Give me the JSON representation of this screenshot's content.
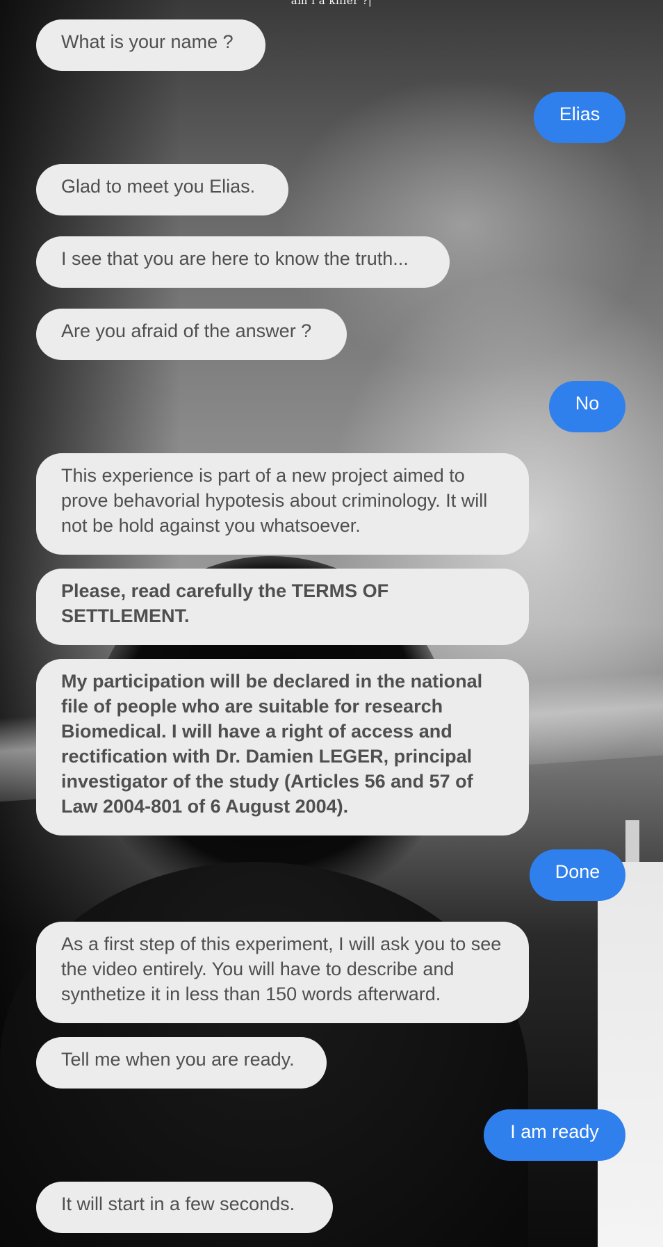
{
  "page": {
    "title": "am i a killer ?|"
  },
  "messages": [
    {
      "sender": "bot",
      "text": "What is your name ?"
    },
    {
      "sender": "user",
      "text": "Elias"
    },
    {
      "sender": "bot",
      "text": "Glad to meet you Elias."
    },
    {
      "sender": "bot",
      "text": "I see that you are here to know the truth..."
    },
    {
      "sender": "bot",
      "text": "Are you afraid of the answer ?"
    },
    {
      "sender": "user",
      "text": "No"
    },
    {
      "sender": "bot",
      "text": "This experience is part of a new project aimed to prove behavorial hypotesis about criminology. It will not be hold against you whatsoever."
    },
    {
      "sender": "bot",
      "text": "Please, read carefully the TERMS OF SETTLEMENT.",
      "bold": true
    },
    {
      "sender": "bot",
      "text": "My participation will be declared in the national file of people who are suitable for research Biomedical. I will have a right of access and rectification with Dr. Damien LEGER, principal investigator of the study (Articles 56 and 57 of Law 2004-801 of 6 August 2004).",
      "bold": true
    },
    {
      "sender": "user",
      "text": "Done"
    },
    {
      "sender": "bot",
      "text": "As a first step of this experiment, I will ask you to see the video entirely. You will have to describe and synthetize it in less than 150 words afterward."
    },
    {
      "sender": "bot",
      "text": "Tell me when you are ready."
    },
    {
      "sender": "user",
      "text": "I am ready"
    },
    {
      "sender": "bot",
      "text": "It will start in a few seconds."
    }
  ],
  "colors": {
    "bot_bubble": "#ececec",
    "bot_text": "#4f4f4f",
    "user_bubble": "#2f80ed",
    "user_text": "#ffffff"
  }
}
